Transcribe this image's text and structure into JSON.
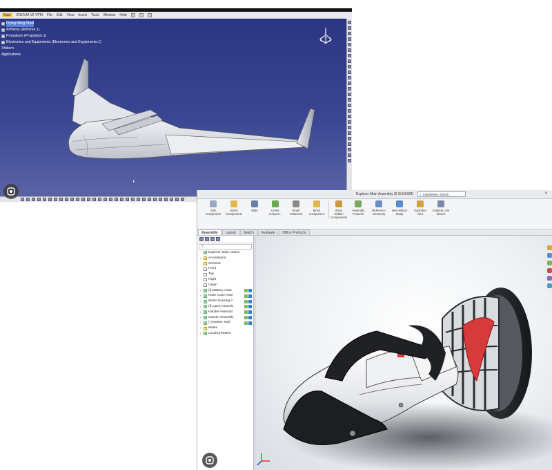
{
  "catia": {
    "menu": [
      "Start",
      "ENOVIA V5 VPM",
      "File",
      "Edit",
      "View",
      "Insert",
      "Tools",
      "Window",
      "Help"
    ],
    "tree": [
      {
        "label": "Flying Wing Shell",
        "selected": true
      },
      {
        "label": "Airframe (Airframe.1)",
        "selected": false
      },
      {
        "label": "Propulsion (Propulsion.1)",
        "selected": false
      },
      {
        "label": "Electronics and Equipments (Electronics and Equipments.1)",
        "selected": false
      },
      {
        "label": "Xhibern",
        "selected": false
      },
      {
        "label": "Applications",
        "selected": false
      }
    ],
    "compass_label": "z",
    "lens_icon": "google-lens-icon"
  },
  "solidworks": {
    "title": "Explorer Main Assembly (5.SLDASM)",
    "search_placeholder": "SolidWorks Search",
    "help_glyph": "?",
    "ribbon": [
      {
        "label": "Edit Component",
        "icon": "edit-component-icon",
        "color": "#9aa7c9"
      },
      {
        "label": "Insert Components",
        "icon": "insert-components-icon",
        "color": "#e3b64a"
      },
      {
        "label": "Mate",
        "icon": "mate-icon",
        "color": "#6b7fa8"
      },
      {
        "label": "Linear Compon...",
        "icon": "linear-pattern-icon",
        "color": "#6aa84f"
      },
      {
        "label": "Smart Fasteners",
        "icon": "smart-fasteners-icon",
        "color": "#8a8a8a"
      },
      {
        "label": "Move Component",
        "icon": "move-component-icon",
        "color": "#e3b64a"
      },
      {
        "label": "Show Hidden Components",
        "icon": "show-hidden-icon",
        "color": "#c99b41"
      },
      {
        "label": "Assembly Features",
        "icon": "assembly-features-icon",
        "color": "#7aa95c"
      },
      {
        "label": "Reference Geometry",
        "icon": "reference-geometry-icon",
        "color": "#6c8cc4"
      },
      {
        "label": "New Motion Study",
        "icon": "motion-study-icon",
        "color": "#5b8bd0"
      },
      {
        "label": "Exploded View",
        "icon": "exploded-view-icon",
        "color": "#d0a340"
      },
      {
        "label": "Explode Line Sketch",
        "icon": "explode-line-icon",
        "color": "#7d8aa8"
      }
    ],
    "tabs": [
      "Assembly",
      "Layout",
      "Sketch",
      "Evaluate",
      "Office Products"
    ],
    "active_tab": "Assembly",
    "filter_glyph": "▽",
    "tree": [
      {
        "label": "Explorer Main Assem",
        "icon": "g",
        "mates": 0,
        "expander": ""
      },
      {
        "label": "Annotations",
        "icon": "y",
        "mates": 0,
        "expander": "+"
      },
      {
        "label": "Sensors",
        "icon": "y",
        "mates": 0,
        "expander": ""
      },
      {
        "label": "Front",
        "icon": "p",
        "mates": 0,
        "expander": ""
      },
      {
        "label": "Top",
        "icon": "p",
        "mates": 0,
        "expander": ""
      },
      {
        "label": "Right",
        "icon": "p",
        "mates": 0,
        "expander": ""
      },
      {
        "label": "Origin",
        "icon": "p",
        "mates": 0,
        "expander": ""
      },
      {
        "label": "(f) Battery Hous",
        "icon": "g",
        "mates": 2,
        "expander": "+"
      },
      {
        "label": "Nose Cone Asse",
        "icon": "g",
        "mates": 2,
        "expander": "+"
      },
      {
        "label": "Motor Housing A",
        "icon": "g",
        "mates": 2,
        "expander": "+"
      },
      {
        "label": "(f) Latch Assemb",
        "icon": "g",
        "mates": 2,
        "expander": "+"
      },
      {
        "label": "Handle Assembl",
        "icon": "g",
        "mates": 2,
        "expander": "+"
      },
      {
        "label": "Nozzle Assembly",
        "icon": "g",
        "mates": 2,
        "expander": "+"
      },
      {
        "label": "(-) Master Swit",
        "icon": "g",
        "mates": 2,
        "expander": "+"
      },
      {
        "label": "Mates",
        "icon": "y",
        "mates": 0,
        "expander": "+"
      },
      {
        "label": "LocalCirPattern",
        "icon": "g",
        "mates": 0,
        "expander": "+"
      }
    ],
    "lens_icon": "google-lens-icon"
  }
}
